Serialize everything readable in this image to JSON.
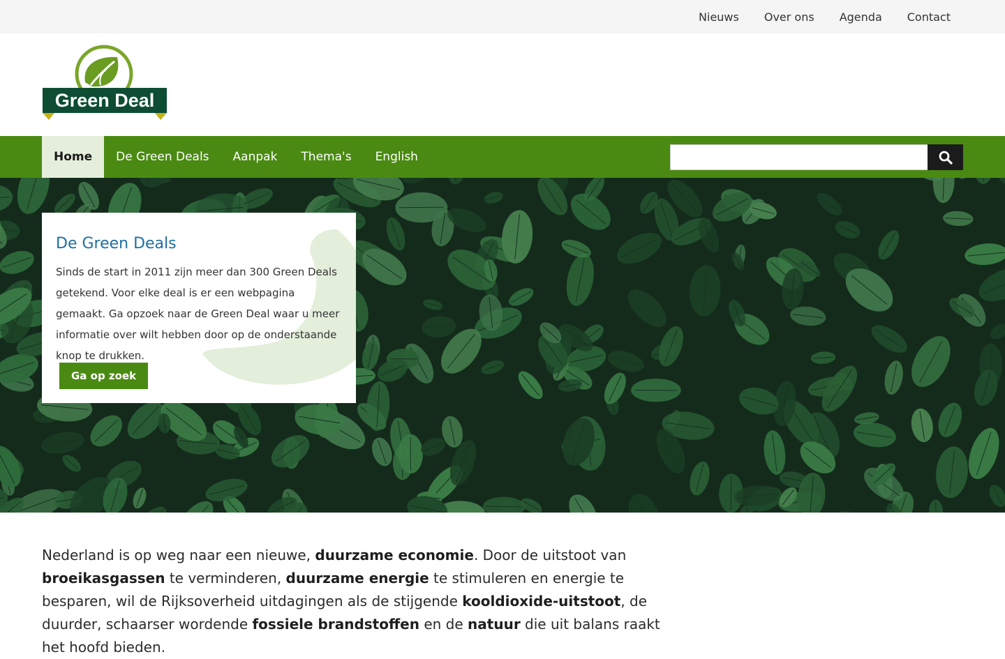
{
  "topnav": {
    "items": [
      "Nieuws",
      "Over ons",
      "Agenda",
      "Contact"
    ]
  },
  "logo": {
    "text": "Green Deal",
    "icon": "leaf-icon"
  },
  "mainnav": {
    "items": [
      "Home",
      "De Green Deals",
      "Aanpak",
      "Thema's",
      "English"
    ],
    "active": "Home"
  },
  "search": {
    "placeholder": "",
    "icon": "search-icon"
  },
  "hero": {
    "card": {
      "title": "De Green Deals",
      "text": "Sinds de start in 2011 zijn meer dan 300 Green Deals getekend. Voor elke deal is er een webpagina gemaakt. Ga opzoek naar de Green Deal waar u meer informatie over wilt hebben door op de onderstaande knop te drukken.",
      "button": "Ga op zoek"
    }
  },
  "intro": {
    "segments": [
      {
        "t": "Nederland is op weg naar een nieuwe, "
      },
      {
        "t": "duurzame economie",
        "b": true
      },
      {
        "t": ". Door de uitstoot van "
      },
      {
        "t": "broeikasgassen",
        "b": true
      },
      {
        "t": " te verminderen, "
      },
      {
        "t": "duurzame energie",
        "b": true
      },
      {
        "t": " te stimuleren en energie te besparen, wil de Rijksoverheid uitdagingen als de stijgende "
      },
      {
        "t": "kooldioxide-uitstoot",
        "b": true
      },
      {
        "t": ", de duurder, schaarser wordende "
      },
      {
        "t": "fossiele brandstoffen",
        "b": true
      },
      {
        "t": " en de "
      },
      {
        "t": "natuur",
        "b": true
      },
      {
        "t": " die uit balans raakt het hoofd bieden."
      }
    ]
  },
  "colors": {
    "brand_green": "#4a8a12",
    "active_bg": "#e5eedb",
    "title_blue": "#1d6fa3",
    "topbar_bg": "#f5f5f5",
    "search_button": "#1b1b1b"
  }
}
